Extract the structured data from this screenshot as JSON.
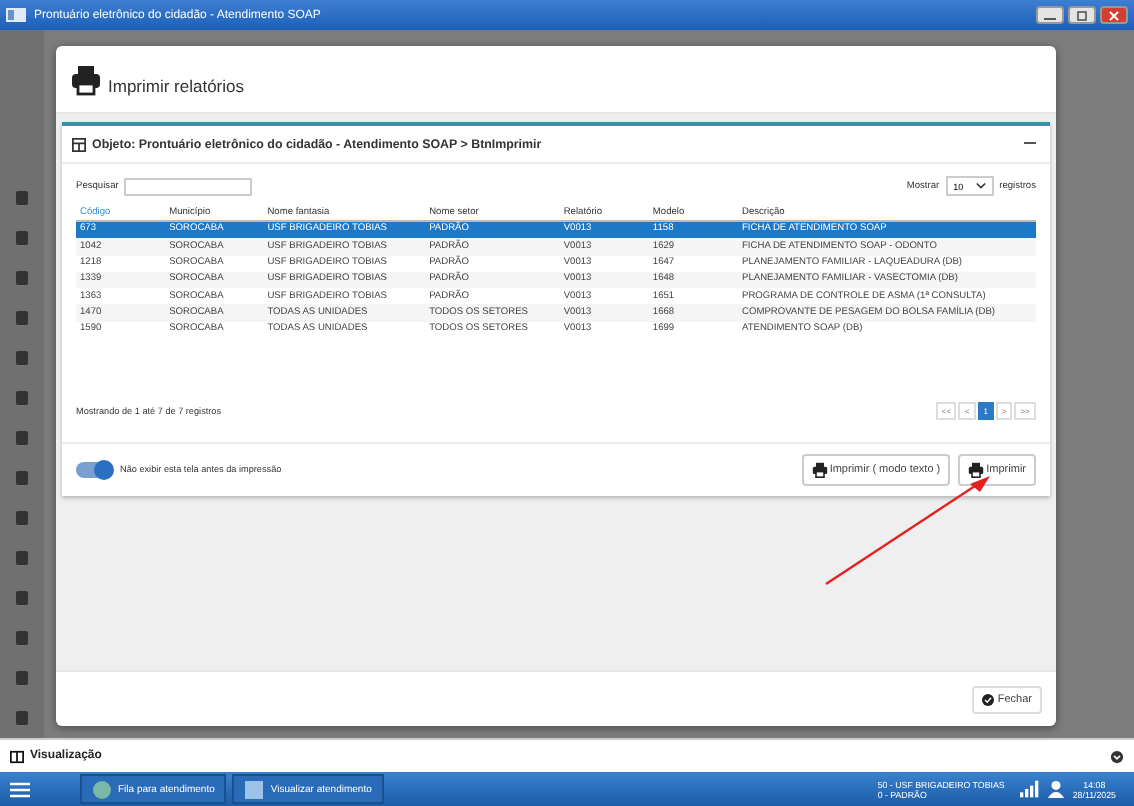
{
  "window": {
    "title": "Prontuário eletrônico do cidadão - Atendimento SOAP"
  },
  "modal": {
    "title": "Imprimir relatórios",
    "panel_title": "Objeto: Prontuário eletrônico do cidadão - Atendimento SOAP > BtnImprimir",
    "search_label": "Pesquisar",
    "show_label": "Mostrar",
    "page_size": "10",
    "show_suffix": "registros",
    "columns": [
      {
        "label": "Código",
        "sorted": true
      },
      {
        "label": "Município",
        "sorted": false
      },
      {
        "label": "Nome fantasia",
        "sorted": false
      },
      {
        "label": "Nome setor",
        "sorted": false
      },
      {
        "label": "Relatório",
        "sorted": false
      },
      {
        "label": "Modelo",
        "sorted": false
      },
      {
        "label": "Descrição",
        "sorted": false
      }
    ],
    "rows": [
      {
        "cells": [
          "673",
          "SOROCABA",
          "USF BRIGADEIRO TOBIAS",
          "PADRÃO",
          "V0013",
          "1158",
          "FICHA DE ATENDIMENTO SOAP"
        ],
        "selected": true
      },
      {
        "cells": [
          "1042",
          "SOROCABA",
          "USF BRIGADEIRO TOBIAS",
          "PADRÃO",
          "V0013",
          "1629",
          "FICHA DE ATENDIMENTO SOAP - ODONTO"
        ],
        "selected": false
      },
      {
        "cells": [
          "1218",
          "SOROCABA",
          "USF BRIGADEIRO TOBIAS",
          "PADRÃO",
          "V0013",
          "1647",
          "PLANEJAMENTO FAMILIAR - LAQUEADURA (DB)"
        ],
        "selected": false
      },
      {
        "cells": [
          "1339",
          "SOROCABA",
          "USF BRIGADEIRO TOBIAS",
          "PADRÃO",
          "V0013",
          "1648",
          "PLANEJAMENTO FAMILIAR - VASECTOMIA (DB)"
        ],
        "selected": false
      },
      {
        "cells": [
          "1363",
          "SOROCABA",
          "USF BRIGADEIRO TOBIAS",
          "PADRÃO",
          "V0013",
          "1651",
          "PROGRAMA DE CONTROLE DE ASMA (1ª CONSULTA)"
        ],
        "selected": false
      },
      {
        "cells": [
          "1470",
          "SOROCABA",
          "TODAS AS UNIDADES",
          "TODOS OS SETORES",
          "V0013",
          "1668",
          "COMPROVANTE DE PESAGEM DO BOLSA FAMÍLIA (DB)"
        ],
        "selected": false
      },
      {
        "cells": [
          "1590",
          "SOROCABA",
          "TODAS AS UNIDADES",
          "TODOS OS SETORES",
          "V0013",
          "1699",
          "ATENDIMENTO SOAP (DB)"
        ],
        "selected": false
      }
    ],
    "info": "Mostrando de 1 até 7 de 7 registros",
    "pages": [
      {
        "label": "<<",
        "selected": false
      },
      {
        "label": "<",
        "selected": false
      },
      {
        "label": "1",
        "selected": true
      },
      {
        "label": ">",
        "selected": false
      },
      {
        "label": ">>",
        "selected": false
      }
    ],
    "toggle": {
      "label": "Não exibir esta tela antes da impressão",
      "on": true
    },
    "buttons": [
      "Imprimir ( modo texto )",
      "Imprimir"
    ],
    "close_button": "Fechar"
  },
  "bottom_bar": {
    "title": "Visualização"
  },
  "taskbar": {
    "tasks": [
      "Fila para atendimento",
      "Visualizar atendimento"
    ],
    "unit": "50 - USF BRIGADEIRO TOBIAS",
    "sector": "0 - PADRÃO",
    "time": "14:08",
    "date": "28/11/2025"
  }
}
